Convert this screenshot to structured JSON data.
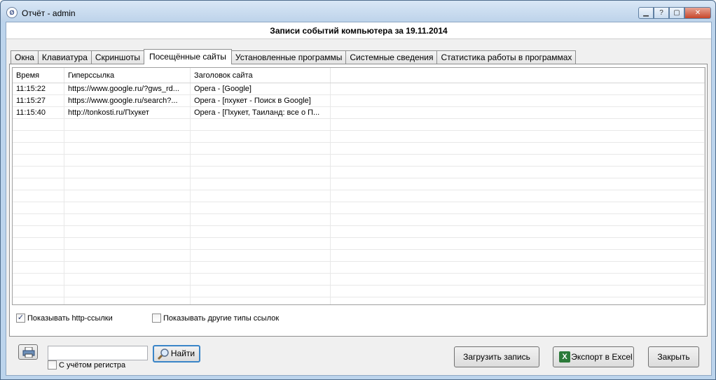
{
  "window": {
    "title": "Отчёт - admin",
    "controls": [
      "?",
      "close"
    ]
  },
  "header": {
    "title": "Записи событий компьютера за 19.11.2014"
  },
  "tabs": [
    {
      "label": "Окна"
    },
    {
      "label": "Клавиатура"
    },
    {
      "label": "Скриншоты"
    },
    {
      "label": "Посещённые сайты",
      "active": true
    },
    {
      "label": "Установленные программы"
    },
    {
      "label": "Системные сведения"
    },
    {
      "label": "Статистика работы в программах"
    }
  ],
  "table": {
    "columns": [
      "Время",
      "Гиперссылка",
      "Заголовок сайта"
    ],
    "rows": [
      [
        "11:15:22",
        "https://www.google.ru/?gws_rd...",
        "Opera - [Google]"
      ],
      [
        "11:15:27",
        "https://www.google.ru/search?...",
        "Opera - [пхукет - Поиск в Google]"
      ],
      [
        "11:15:40",
        "http://tonkosti.ru/Пхукет",
        "Opera - [Пхукет, Таиланд: все о П..."
      ]
    ]
  },
  "options": {
    "show_http": {
      "label": "Показывать http-ссылки",
      "checked": true
    },
    "show_other": {
      "label": "Показывать другие типы ссылок",
      "checked": false
    }
  },
  "search": {
    "value": "",
    "find_label": "Найти",
    "case_label": "С учётом регистра",
    "case_checked": false
  },
  "buttons": {
    "load": "Загрузить запись",
    "export": "Экспорт в Excel",
    "close": "Закрыть"
  },
  "icons": {
    "excel": "X"
  }
}
